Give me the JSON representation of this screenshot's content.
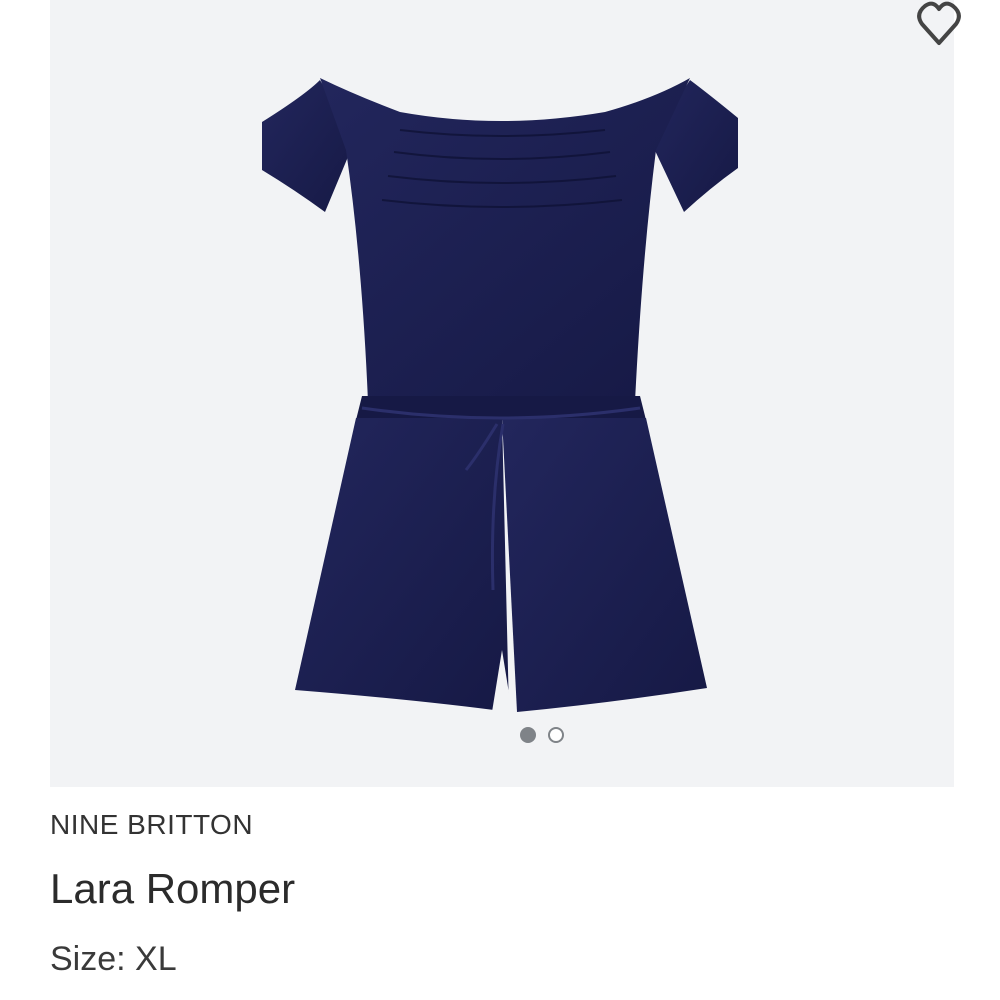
{
  "product": {
    "brand": "NINE BRITTON",
    "name": "Lara Romper",
    "size_label": "Size:",
    "size_value": "XL",
    "size_text": "Size: XL"
  },
  "gallery": {
    "image_subject": "navy off-shoulder romper",
    "active_index": 1,
    "total": 2
  },
  "icons": {
    "favorite": "heart-icon"
  },
  "colors": {
    "garment": "#1b1f52",
    "panel_bg": "#f2f3f5",
    "dot_active": "#7f8388"
  }
}
